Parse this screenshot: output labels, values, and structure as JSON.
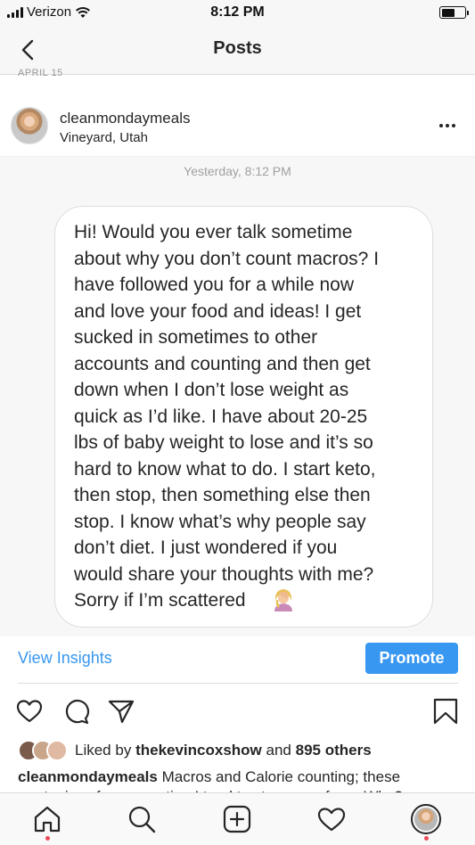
{
  "status_bar": {
    "carrier": "Verizon",
    "time": "8:12 PM",
    "battery_level": 0.6
  },
  "nav": {
    "title": "Posts",
    "back_icon": "chevron-left-icon"
  },
  "previous_post_date": "APRIL 15",
  "post": {
    "username": "cleanmondaymeals",
    "location": "Vineyard, Utah",
    "more_icon": "ellipsis-icon",
    "image": {
      "timestamp": "Yesterday, 8:12 PM",
      "message": "Hi! Would you ever talk sometime\nabout why you don’t count macros? I\nhave followed you for a while now\nand love your food and ideas! I get\nsucked in sometimes to other\naccounts and counting and then get\ndown when I don’t lose weight as\nquick as I’d like. I have about 20-25\nlbs of baby weight to lose and it’s so\nhard to know what to do. I start keto,\nthen stop, then something else then\nstop. I know what’s why people say\ndon’t diet. I just wondered if you\nwould share your thoughts with me?\nSorry if I’m scattered",
      "emoji": "person-facepalming-emoji"
    },
    "view_insights": "View Insights",
    "promote": "Promote",
    "actions": [
      "heart-icon",
      "comment-icon",
      "share-icon",
      "bookmark-icon"
    ],
    "likes": {
      "prefix": "Liked by",
      "user": "thekevincoxshow",
      "middle": "and",
      "others": "895 others"
    },
    "caption": {
      "username": "cleanmondaymeals",
      "text": "Macros and Calorie counting; these",
      "next_line": "are topics of conversation I tend to stay away from. Why?"
    },
    "accent_color": "#3897f0"
  },
  "tab_bar": {
    "items": [
      "home-icon",
      "search-icon",
      "add-post-icon",
      "activity-heart-icon",
      "profile-avatar"
    ],
    "notification_color": "#ed4956"
  }
}
